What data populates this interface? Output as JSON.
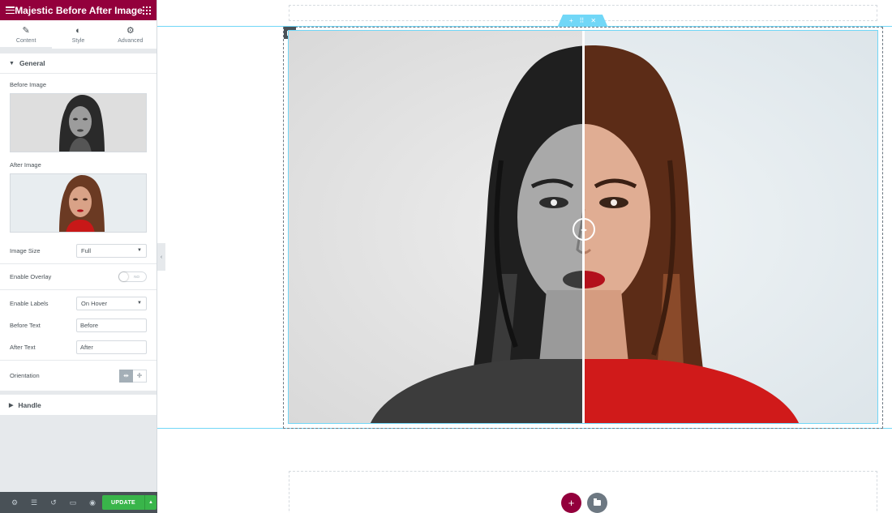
{
  "panel": {
    "title": "Majestic Before After Image",
    "tabs": [
      {
        "label": "Content",
        "icon": "pencil-icon"
      },
      {
        "label": "Style",
        "icon": "half-circle-icon"
      },
      {
        "label": "Advanced",
        "icon": "gear-icon"
      }
    ]
  },
  "general": {
    "heading": "General",
    "before_image_label": "Before Image",
    "after_image_label": "After Image",
    "image_size_label": "Image Size",
    "image_size_value": "Full",
    "enable_overlay_label": "Enable Overlay",
    "enable_overlay_state": "NO",
    "enable_labels_label": "Enable Labels",
    "enable_labels_value": "On Hover",
    "before_text_label": "Before Text",
    "before_text_value": "Before",
    "after_text_label": "After Text",
    "after_text_value": "After",
    "orientation_label": "Orientation"
  },
  "handle_section": {
    "heading": "Handle"
  },
  "footer": {
    "update_label": "UPDATE"
  },
  "colors": {
    "brand": "#93003c",
    "update_green": "#39b54a",
    "editor_blue": "#71d7f7",
    "after_shirt_red": "#d01a1a"
  },
  "widget": {
    "slider_position_percent": 50
  }
}
